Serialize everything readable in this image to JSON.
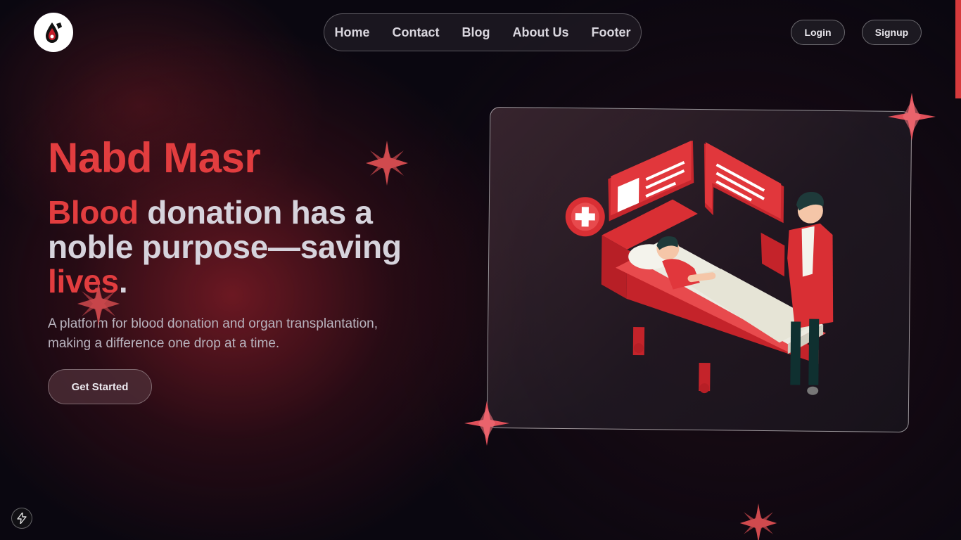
{
  "brand": {
    "logo_icon": "blood-drop-logo-icon"
  },
  "nav": {
    "items": [
      {
        "label": "Home"
      },
      {
        "label": "Contact"
      },
      {
        "label": "Blog"
      },
      {
        "label": "About Us"
      },
      {
        "label": "Footer"
      }
    ]
  },
  "auth": {
    "login_label": "Login",
    "signup_label": "Signup"
  },
  "hero": {
    "title": "Nabd Masr",
    "headline_accent1": "Blood",
    "headline_mid": " donation has a noble purpose—saving ",
    "headline_accent2": "lives",
    "headline_end": ".",
    "subtext": "A platform for blood donation and organ transplantation, making a difference one drop at a time.",
    "cta_label": "Get Started"
  },
  "illustration": {
    "name": "hospital-bed-doctor-illustration"
  },
  "colors": {
    "accent": "#e23d3f",
    "background": "#0a0710",
    "text": "#d6d3dc"
  }
}
